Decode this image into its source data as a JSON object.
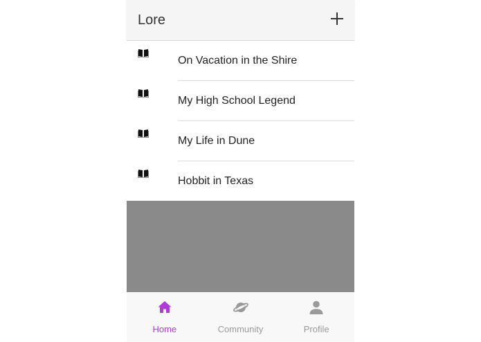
{
  "header": {
    "title": "Lore",
    "add_icon": "plus-icon"
  },
  "stories": [
    {
      "title": "On Vacation in the Shire",
      "icon": "book-icon"
    },
    {
      "title": "My High School Legend",
      "icon": "book-icon"
    },
    {
      "title": "My Life in Dune",
      "icon": "book-icon"
    },
    {
      "title": "Hobbit in Texas",
      "icon": "book-icon"
    }
  ],
  "tabs": [
    {
      "label": "Home",
      "icon": "home-icon",
      "active": true
    },
    {
      "label": "Community",
      "icon": "planet-icon",
      "active": false
    },
    {
      "label": "Profile",
      "icon": "person-icon",
      "active": false
    }
  ],
  "colors": {
    "accent": "#b13bd8",
    "inactive": "#9a9a9a",
    "overlay": "#8a8a8b"
  }
}
